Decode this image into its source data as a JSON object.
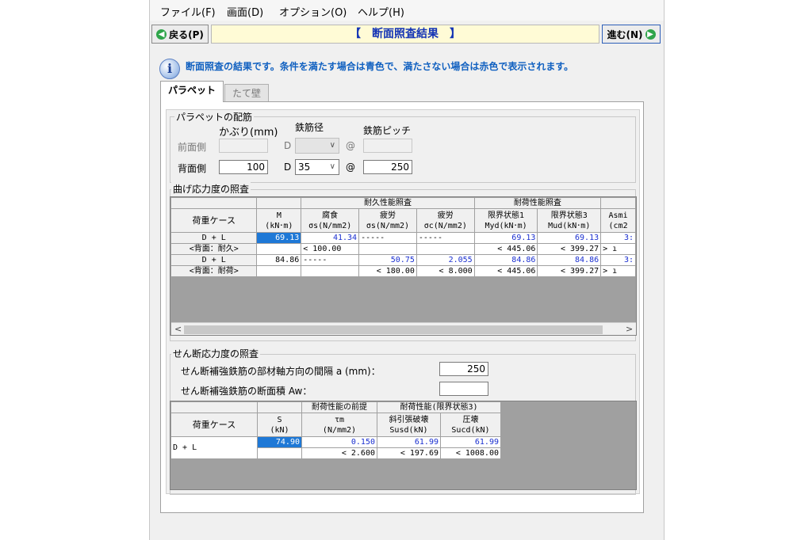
{
  "menu": [
    "ファイル(F)",
    "画面(D)",
    "オプション(O)",
    "ヘルプ(H)"
  ],
  "titlebar": {
    "back_label": "戻る(P)",
    "title": "【　断面照査結果　】",
    "next_label": "進む(N)"
  },
  "info_text": "断面照査の結果です。条件を満たす場合は青色で、満たさない場合は赤色で表示されます。",
  "tabs": [
    {
      "label": "パラペット",
      "active": true
    },
    {
      "label": "たて壁",
      "active": false
    }
  ],
  "rebar": {
    "group_title": "パラペットの配筋",
    "col_cover": "かぶり(mm)",
    "col_dia": "鉄筋径",
    "col_pitch": "鉄筋ピッチ",
    "front_label": "前面側",
    "back_label": "背面側",
    "d_symbol": "D",
    "at_symbol": "@",
    "back_cover": "100",
    "back_dia": "35",
    "back_pitch": "250"
  },
  "bending": {
    "group_title": "曲げ応力度の照査",
    "hdr": {
      "group_durable": "耐久性能照査",
      "group_load": "耐荷性能照査",
      "case": "荷重ケース",
      "M": "M",
      "M_unit": "(kN･m)",
      "corr": "腐食",
      "corr_unit": "σs(N/mm2)",
      "fat1": "疲労",
      "fat1_unit": "σs(N/mm2)",
      "fat2": "疲労",
      "fat2_unit": "σc(N/mm2)",
      "lim1": "限界状態1",
      "lim1_unit": "Myd(kN･m)",
      "lim3": "限界状態3",
      "lim3_unit": "Mud(kN･m)",
      "asm": "Asmi",
      "asm_unit": "(cm2"
    },
    "rows": [
      {
        "case_line1": "D + L",
        "case_line2": "<背面：耐久>",
        "M": "69.13",
        "corr": "41.34",
        "fat1": "-----",
        "fat2": "-----",
        "lim1": "69.13",
        "lim3": "69.13",
        "asm": "3:",
        "corr_lim": "<  100.00",
        "fat1_lim": "",
        "fat2_lim": "",
        "lim1_lim": "< 445.06",
        "lim3_lim": "< 399.27",
        "asm_lim": ">  ı"
      },
      {
        "case_line1": "D + L",
        "case_line2": "<背面：耐荷>",
        "M": "84.86",
        "corr": "-----",
        "fat1": "50.75",
        "fat2": "2.055",
        "lim1": "84.86",
        "lim3": "84.86",
        "asm": "3:",
        "corr_lim": "",
        "fat1_lim": "<  180.00",
        "fat2_lim": "<   8.000",
        "lim1_lim": "< 445.06",
        "lim3_lim": "< 399.27",
        "asm_lim": ">  ı"
      }
    ]
  },
  "shear": {
    "group_title": "せん断応力度の照査",
    "spacing_label": "せん断補強鉄筋の部材軸方向の間隔 a (mm)：",
    "spacing_value": "250",
    "area_label": "せん断補強鉄筋の断面積 Aw：",
    "area_value": "",
    "hdr": {
      "group_pre": "耐荷性能の前提",
      "group_lim": "耐荷性能(限界状態3)",
      "case": "荷重ケース",
      "S": "S",
      "S_unit": "(kN)",
      "tau": "τm",
      "tau_unit": "(N/mm2)",
      "susd": "斜引張破壊",
      "susd_unit": "Susd(kN)",
      "sucd": "圧壊",
      "sucd_unit": "Sucd(kN)"
    },
    "row": {
      "case": "D + L",
      "S": "74.90",
      "tau": "0.150",
      "susd": "61.99",
      "sucd": "61.99",
      "tau_lim": "<   2.600",
      "susd_lim": "< 197.69",
      "sucd_lim": "< 1008.00"
    }
  }
}
